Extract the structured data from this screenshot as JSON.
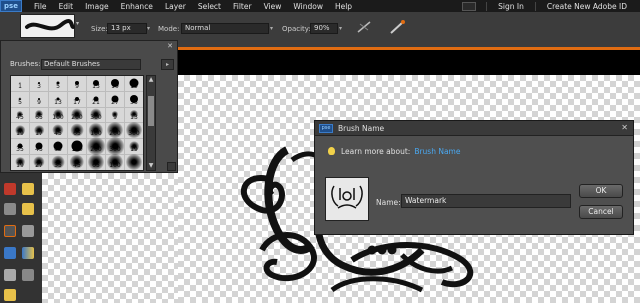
{
  "app": {
    "logo": "pse"
  },
  "menu": {
    "items": [
      "File",
      "Edit",
      "Image",
      "Enhance",
      "Layer",
      "Select",
      "Filter",
      "View",
      "Window",
      "Help"
    ],
    "sign_in": "Sign In",
    "create_id": "Create New Adobe ID"
  },
  "options_bar": {
    "size_label": "Size:",
    "size_value": "13 px",
    "mode_label": "Mode:",
    "mode_value": "Normal",
    "opacity_label": "Opacity:",
    "opacity_value": "90%"
  },
  "brush_picker": {
    "label": "Brushes:",
    "selected_set": "Default Brushes",
    "presets": [
      {
        "num": "1",
        "d": 1,
        "soft": false
      },
      {
        "num": "3",
        "d": 2,
        "soft": false
      },
      {
        "num": "5",
        "d": 3,
        "soft": false
      },
      {
        "num": "9",
        "d": 4,
        "soft": false
      },
      {
        "num": "13",
        "d": 6,
        "soft": false
      },
      {
        "num": "19",
        "d": 8,
        "soft": false
      },
      {
        "num": "19",
        "d": 9,
        "soft": false
      },
      {
        "num": "5",
        "d": 2,
        "soft": true
      },
      {
        "num": "9",
        "d": 2,
        "soft": false
      },
      {
        "num": "13",
        "d": 3,
        "soft": false
      },
      {
        "num": "17",
        "d": 4,
        "soft": false
      },
      {
        "num": "21",
        "d": 5,
        "soft": false
      },
      {
        "num": "27",
        "d": 7,
        "soft": false
      },
      {
        "num": "35",
        "d": 8,
        "soft": false
      },
      {
        "num": "45",
        "d": 4,
        "soft": true
      },
      {
        "num": "65",
        "d": 5,
        "soft": true
      },
      {
        "num": "100",
        "d": 6,
        "soft": true
      },
      {
        "num": "200",
        "d": 7,
        "soft": true
      },
      {
        "num": "300",
        "d": 7,
        "soft": true
      },
      {
        "num": "9",
        "d": 4,
        "soft": true
      },
      {
        "num": "13",
        "d": 5,
        "soft": true
      },
      {
        "num": "19",
        "d": 6,
        "soft": true
      },
      {
        "num": "17",
        "d": 6,
        "soft": true
      },
      {
        "num": "45",
        "d": 7,
        "soft": true
      },
      {
        "num": "65",
        "d": 8,
        "soft": true
      },
      {
        "num": "100",
        "d": 9,
        "soft": true
      },
      {
        "num": "200",
        "d": 10,
        "soft": true
      },
      {
        "num": "300",
        "d": 10,
        "soft": true
      },
      {
        "num": "35",
        "d": 5,
        "soft": false
      },
      {
        "num": "45",
        "d": 7,
        "soft": false
      },
      {
        "num": "65",
        "d": 9,
        "soft": false
      },
      {
        "num": "100",
        "d": 11,
        "soft": false
      },
      {
        "num": "200",
        "d": 11,
        "soft": true
      },
      {
        "num": "300",
        "d": 11,
        "soft": true
      },
      {
        "num": "19",
        "d": 6,
        "soft": true
      },
      {
        "num": "19",
        "d": 6,
        "soft": true
      },
      {
        "num": "27",
        "d": 7,
        "soft": true
      },
      {
        "num": "35",
        "d": 8,
        "soft": true
      },
      {
        "num": "45",
        "d": 9,
        "soft": true
      },
      {
        "num": "65",
        "d": 10,
        "soft": true
      },
      {
        "num": "100",
        "d": 10,
        "soft": true
      },
      {
        "num": "",
        "d": 10,
        "soft": true
      }
    ]
  },
  "dialog": {
    "logo": "pse",
    "title": "Brush Name",
    "learn_text": "Learn more about:",
    "learn_link": "Brush Name",
    "name_label": "Name:",
    "name_value": "Watermark",
    "ok_label": "OK",
    "cancel_label": "Cancel"
  }
}
